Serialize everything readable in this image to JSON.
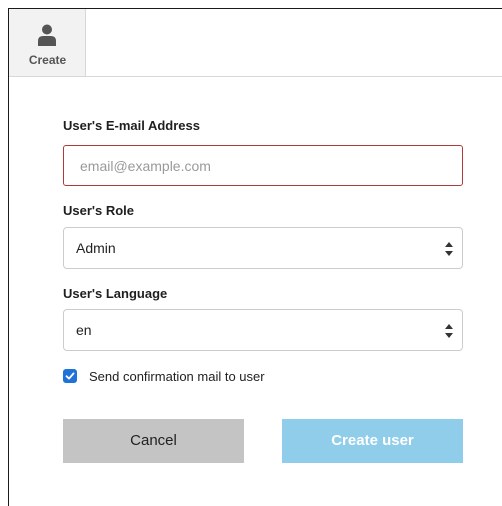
{
  "toolbar": {
    "create_label": "Create",
    "create_icon": "user-icon"
  },
  "form": {
    "email": {
      "label": "User's E-mail Address",
      "placeholder": "email@example.com",
      "value": ""
    },
    "role": {
      "label": "User's Role",
      "selected": "Admin"
    },
    "language": {
      "label": "User's Language",
      "selected": "en"
    },
    "send_confirmation": {
      "label": "Send confirmation mail to user",
      "checked": true
    },
    "buttons": {
      "cancel_label": "Cancel",
      "create_label": "Create user"
    }
  },
  "colors": {
    "error_border": "#b03a3a",
    "checkbox_accent": "#1f73d8",
    "cancel_bg": "#c4c4c4",
    "create_bg": "#8fcdea"
  }
}
